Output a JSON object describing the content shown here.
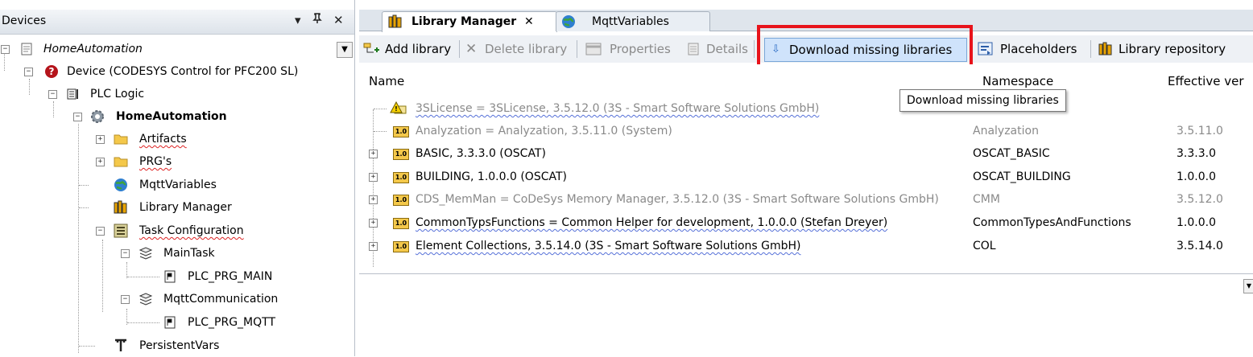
{
  "devices": {
    "title": "Devices",
    "controls": {
      "dropdown": "▾",
      "pin": "ᵖ",
      "close": "✕"
    },
    "combo_value": "HomeAutomation",
    "tree": [
      {
        "label": "Device (CODESYS Control for PFC200 SL)"
      },
      {
        "label": "PLC Logic"
      },
      {
        "label": "HomeAutomation"
      },
      {
        "label": "Artifacts"
      },
      {
        "label": "PRG's"
      },
      {
        "label": "MqttVariables"
      },
      {
        "label": "Library Manager"
      },
      {
        "label": "Task Configuration"
      },
      {
        "label": "MainTask"
      },
      {
        "label": "PLC_PRG_MAIN"
      },
      {
        "label": "MqttCommunication"
      },
      {
        "label": "PLC_PRG_MQTT"
      },
      {
        "label": "PersistentVars"
      }
    ]
  },
  "tabs": [
    {
      "label": "Library Manager",
      "close": "✕"
    },
    {
      "label": "MqttVariables"
    }
  ],
  "toolbar": {
    "add": "Add library",
    "delete": "Delete library",
    "properties": "Properties",
    "details": "Details",
    "download": "Download missing libraries",
    "placeholders": "Placeholders",
    "repository": "Library repository"
  },
  "tooltip": "Download missing libraries",
  "columns": {
    "name": "Name",
    "namespace": "Namespace",
    "version": "Effective ver"
  },
  "libraries": [
    {
      "name": "3SLicense = 3SLicense, 3.5.12.0 (3S - Smart Software Solutions GmbH)",
      "ns": "",
      "ver": ""
    },
    {
      "name": "Analyzation = Analyzation, 3.5.11.0 (System)",
      "ns": "Analyzation",
      "ver": "3.5.11.0"
    },
    {
      "name": "BASIC, 3.3.3.0 (OSCAT)",
      "ns": "OSCAT_BASIC",
      "ver": "3.3.3.0"
    },
    {
      "name": "BUILDING, 1.0.0.0 (OSCAT)",
      "ns": "OSCAT_BUILDING",
      "ver": "1.0.0.0"
    },
    {
      "name": "CDS_MemMan = CoDeSys Memory Manager, 3.5.12.0 (3S - Smart Software Solutions GmbH)",
      "ns": "CMM",
      "ver": "3.5.12.0"
    },
    {
      "name": "CommonTypsFunctions = Common Helper for development, 1.0.0.0 (Stefan Dreyer)",
      "ns": "CommonTypesAndFunctions",
      "ver": "1.0.0.0"
    },
    {
      "name": "Element Collections, 3.5.14.0 (3S - Smart Software Solutions GmbH)",
      "ns": "COL",
      "ver": "3.5.14.0"
    }
  ],
  "lib_badge": "1.0",
  "colors": {
    "highlight": "#e8131b",
    "selected_btn": "#cfe3fb"
  }
}
